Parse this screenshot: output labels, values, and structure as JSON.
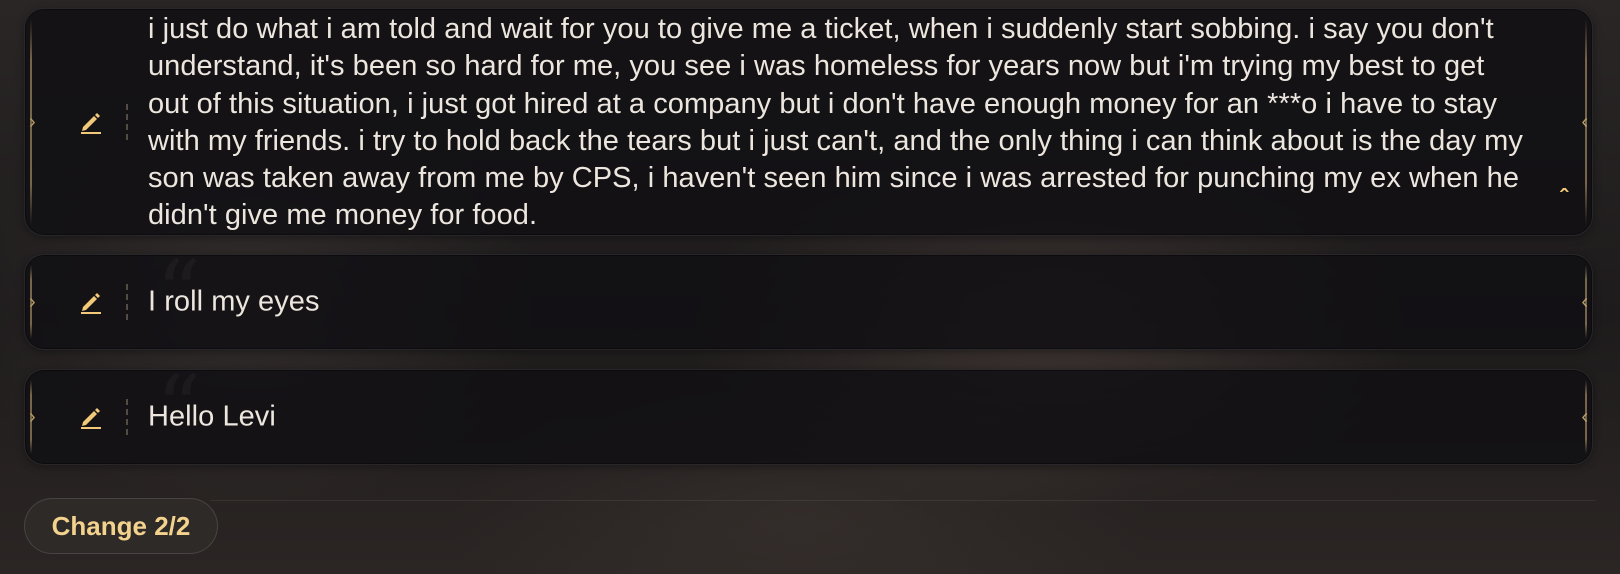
{
  "messages": [
    {
      "text": "i just do what i am told and wait for you to give me a ticket, when i suddenly start sobbing. i say you don't understand, it's been so hard for me, you see i was homeless for years now but i'm trying my best to get out of this situation, i just got hired at a company but i don't have enough money for an ***o i have to stay with my friends. i try to hold back the tears but i just can't, and the only thing i can think about is the day my son was taken away from me by CPS, i haven't seen him since i was arrested for punching my ex when he didn't give me money for food.",
      "icon": "pencil-icon",
      "expanded": true
    },
    {
      "text": "I roll my eyes",
      "icon": "pencil-icon"
    },
    {
      "text": "Hello Levi",
      "icon": "pencil-icon"
    }
  ],
  "change_button": {
    "label": "Change 2/2"
  },
  "colors": {
    "accent": "#f2c879",
    "card_border": "#b79a66",
    "text": "#ece6de"
  }
}
